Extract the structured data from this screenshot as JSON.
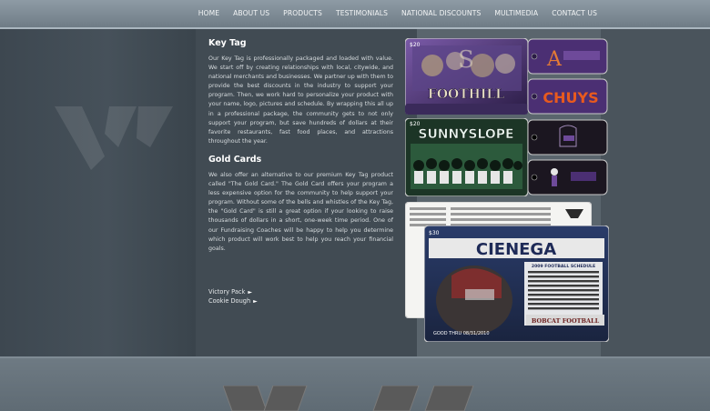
{
  "nav": {
    "items": [
      "HOME",
      "ABOUT US",
      "PRODUCTS",
      "TESTIMONIALS",
      "NATIONAL DISCOUNTS",
      "MULTIMEDIA",
      "CONTACT US"
    ]
  },
  "sections": {
    "key_tag": {
      "title": "Key Tag",
      "body": "Our Key Tag is professionally packaged and loaded with value. We start off by creating relationships with local, citywide, and national merchants and businesses. We partner up with them to provide the best discounts in the industry to support your program. Then, we work hard to personalize your product with your name, logo, pictures and schedule. By wrapping this all up in a professional package, the community gets to not only support your program, but save hundreds of dollars at their favorite restaurants, fast food places, and attractions throughout the year."
    },
    "gold_cards": {
      "title": "Gold Cards",
      "body": "We also offer an alternative to our premium Key Tag product called \"The Gold Card.\" The Gold Card offers your program a less expensive option for the community to help support your program. Without some of the bells and whistles of the Key Tag, the \"Gold Card\" is still a great option if your looking to raise thousands of dollars in a short, one-week time period. One of our Fundraising Coaches will be happy to help you determine which product will work best to help you reach your financial goals."
    }
  },
  "links": [
    "Victory Pack",
    "Cookie Dough"
  ],
  "cards": {
    "card1": {
      "price": "$20",
      "team": "FOOTHILL"
    },
    "tag1": "A",
    "tag2": "CHUYS",
    "card2": {
      "price": "$20",
      "team": "SUNNYSLOPE"
    },
    "card3": {
      "price": "$30",
      "team": "CIENEGA",
      "schedule_title": "2009 FOOTBALL SCHEDULE",
      "footer_text": "BOBCAT FOOTBALL",
      "valid": "GOOD THRU 08/31/2010"
    }
  },
  "colors": {
    "nav_bg": "#7d8a94",
    "card_purple": "#4a2f6e",
    "card_green": "#1e4a34",
    "card_orange": "#e35a1c"
  }
}
